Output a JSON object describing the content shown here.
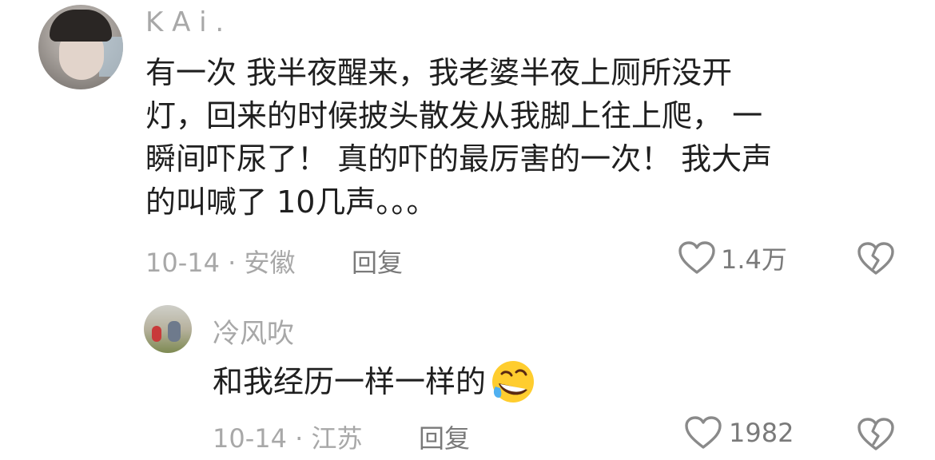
{
  "comment": {
    "username": "K A i .",
    "text_lines": [
      "有一次 我半夜醒来，我老婆半夜上厕所没开",
      "灯，回来的时候披头散发从我脚上往上爬， 一",
      "瞬间吓尿了！ 真的吓的最厉害的一次！ 我大声",
      "的叫喊了 10几声。。。"
    ],
    "meta": "10-14 · 安徽",
    "reply_label": "回复",
    "like_count": "1.4万"
  },
  "reply_comment": {
    "username": "冷风吹",
    "text": "和我经历一样一样的",
    "emoji": "rolling-on-floor-laughing-emoji",
    "meta": "10-14 · 江苏",
    "reply_label": "回复",
    "like_count": "1982"
  },
  "icons": {
    "like": "heart-outline-icon",
    "dislike": "broken-heart-icon"
  },
  "colors": {
    "text": "#1f1f1f",
    "muted": "#a8a8a8",
    "icon": "#7a7a7a"
  }
}
